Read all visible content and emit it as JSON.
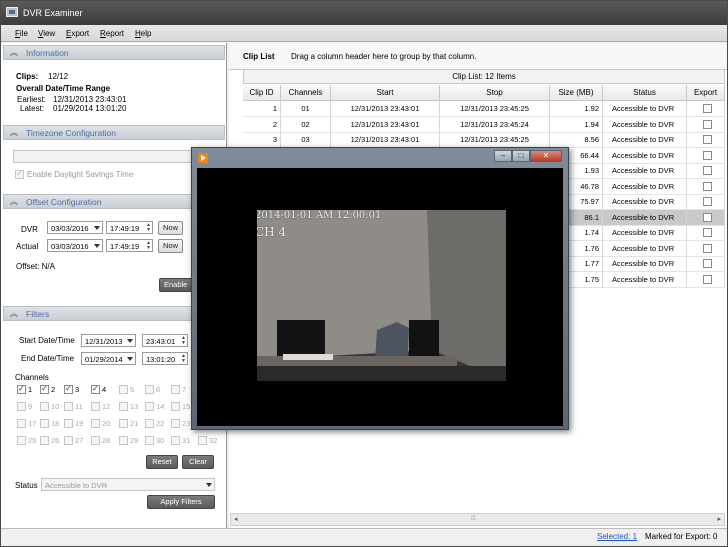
{
  "app": {
    "title": "DVR Examiner"
  },
  "menu": [
    "File",
    "View",
    "Export",
    "Report",
    "Help"
  ],
  "information": {
    "header": "Information",
    "clips_label": "Clips:",
    "clips_value": "12/12",
    "range_title": "Overall Date/Time Range",
    "earliest_label": "Earliest:",
    "earliest_value": "12/31/2013 23:43:01",
    "latest_label": "Latest:",
    "latest_value": "01/29/2014 13:01:20"
  },
  "timezone": {
    "header": "Timezone Configuration",
    "dst_label": "Enable Daylight Savings Time"
  },
  "offset": {
    "header": "Offset Configuration",
    "dvr_label": "DVR",
    "dvr_date": "03/03/2016",
    "dvr_time": "17:49:19",
    "actual_label": "Actual",
    "actual_date": "03/03/2016",
    "actual_time": "17:49:19",
    "now_label": "Now",
    "offset_text": "Offset: N/A",
    "enable_label": "Enable"
  },
  "filters": {
    "header": "Filters",
    "start_label": "Start Date/Time",
    "start_date": "12/31/2013",
    "start_time": "23:43:01",
    "end_label": "End Date/Time",
    "end_date": "01/29/2014",
    "end_time": "13:01:20",
    "channels_label": "Channels",
    "reset_label": "Reset",
    "clear_label": "Clear",
    "status_label": "Status",
    "status_value": "Accessible to DVR",
    "apply_label": "Apply Filters"
  },
  "cliplist": {
    "tab_label": "Clip List",
    "hint": "Drag a column header here to group by that column.",
    "band": "Clip List: 12 Items",
    "columns": [
      "Clip ID",
      "Channels",
      "Start",
      "Stop",
      "Size (MB)",
      "Status",
      "Export"
    ],
    "rows": [
      {
        "id": "1",
        "ch": "01",
        "start": "12/31/2013 23:43:01",
        "stop": "12/31/2013 23:45:25",
        "size": "1.92",
        "status": "Accessible to DVR"
      },
      {
        "id": "2",
        "ch": "02",
        "start": "12/31/2013 23:43:01",
        "stop": "12/31/2013 23:45:24",
        "size": "1.94",
        "status": "Accessible to DVR"
      },
      {
        "id": "3",
        "ch": "03",
        "start": "12/31/2013 23:43:01",
        "stop": "12/31/2013 23:45:25",
        "size": "8.56",
        "status": "Accessible to DVR"
      },
      {
        "id": "",
        "ch": "",
        "start": "",
        "stop": "",
        "size": "66.44",
        "status": "Accessible to DVR"
      },
      {
        "id": "",
        "ch": "",
        "start": "",
        "stop": "",
        "size": "1.93",
        "status": "Accessible to DVR"
      },
      {
        "id": "",
        "ch": "",
        "start": "",
        "stop": "",
        "size": "46.78",
        "status": "Accessible to DVR"
      },
      {
        "id": "",
        "ch": "",
        "start": "",
        "stop": "",
        "size": "75.97",
        "status": "Accessible to DVR"
      },
      {
        "id": "",
        "ch": "",
        "start": "",
        "stop": "",
        "size": "86.1",
        "status": "Accessible to DVR"
      },
      {
        "id": "",
        "ch": "",
        "start": "",
        "stop": "",
        "size": "1.74",
        "status": "Accessible to DVR"
      },
      {
        "id": "",
        "ch": "",
        "start": "",
        "stop": "",
        "size": "1.76",
        "status": "Accessible to DVR"
      },
      {
        "id": "",
        "ch": "",
        "start": "",
        "stop": "",
        "size": "1.77",
        "status": "Accessible to DVR"
      },
      {
        "id": "",
        "ch": "",
        "start": "",
        "stop": "",
        "size": "1.75",
        "status": "Accessible to DVR"
      }
    ]
  },
  "player": {
    "timestamp": "2014-01-01 AM 12:00:01",
    "channel": "CH 4"
  },
  "statusbar": {
    "selected": "Selected: 1",
    "marked": "Marked for Export: 0"
  },
  "colors": {
    "accent": "#4a6fa5",
    "selected_row": "#c9c9c9",
    "title_bar": "#3c3c3c"
  }
}
